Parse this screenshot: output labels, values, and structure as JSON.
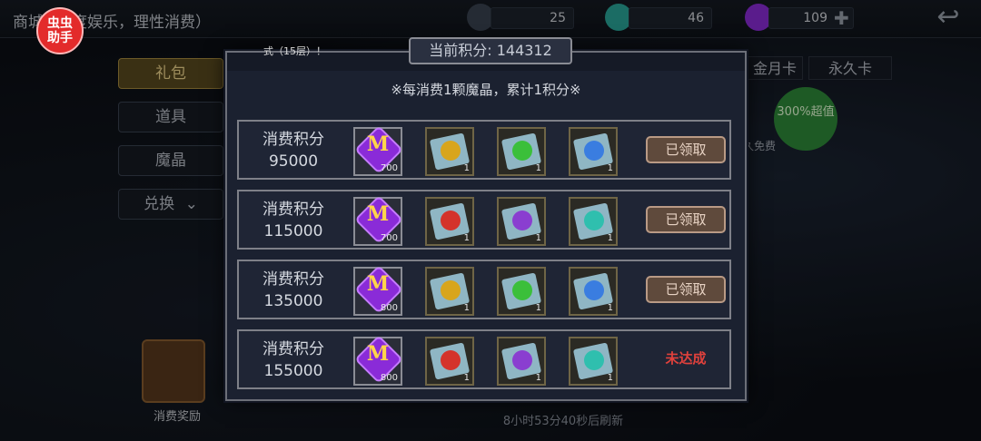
{
  "colors": {
    "modal_bg": "#1b2130",
    "claimed_btn": "#5f4a3c",
    "not_reached": "#e0413c",
    "gem_purple": "#8a2bd8"
  },
  "app_badge": "虫虫助手",
  "shop": {
    "title": "商城",
    "subtitle": "适度娱乐，理性消费）",
    "resources": [
      {
        "icon": "leaf-icon",
        "value": "25"
      },
      {
        "icon": "slime-icon",
        "value": "46"
      },
      {
        "icon": "magic-crystal-icon",
        "value": "109"
      }
    ],
    "side_menu": [
      "礼包",
      "道具",
      "魔晶",
      "兑换"
    ],
    "tabs": [
      "金月卡",
      "永久卡"
    ],
    "promo": "300%超值",
    "promo_sub": "久免费",
    "chest_label": "消费奖励",
    "refresh": "8小时53分40秒后刷新"
  },
  "modal": {
    "floor_note": "式（15层）！",
    "points_label": "当前积分:",
    "points_value": "144312",
    "rule": "※每消费1颗魔晶，累计1积分※",
    "rows": [
      {
        "label": "消费积分",
        "threshold": "95000",
        "gem_qty": "700",
        "items": [
          {
            "icon": "scroll-yellow-rune-icon",
            "qty": "1",
            "seal": "#d8a51c"
          },
          {
            "icon": "scroll-green-rune-icon",
            "qty": "1",
            "seal": "#3bbf3a"
          },
          {
            "icon": "scroll-blue-drop-icon",
            "qty": "1",
            "seal": "#3a7de0"
          }
        ],
        "status": "已领取",
        "claimed": true
      },
      {
        "label": "消费积分",
        "threshold": "115000",
        "gem_qty": "700",
        "items": [
          {
            "icon": "scroll-red-rune-icon",
            "qty": "1",
            "seal": "#d4332b"
          },
          {
            "icon": "scroll-purple-rune-icon",
            "qty": "1",
            "seal": "#8a3ed0"
          },
          {
            "icon": "scroll-teal-rune-icon",
            "qty": "1",
            "seal": "#2fbfae"
          }
        ],
        "status": "已领取",
        "claimed": true
      },
      {
        "label": "消费积分",
        "threshold": "135000",
        "gem_qty": "800",
        "items": [
          {
            "icon": "scroll-yellow-rune-icon",
            "qty": "1",
            "seal": "#d8a51c"
          },
          {
            "icon": "scroll-green-rune-icon",
            "qty": "1",
            "seal": "#3bbf3a"
          },
          {
            "icon": "scroll-blue-drop-icon",
            "qty": "1",
            "seal": "#3a7de0"
          }
        ],
        "status": "已领取",
        "claimed": true
      },
      {
        "label": "消费积分",
        "threshold": "155000",
        "gem_qty": "800",
        "items": [
          {
            "icon": "scroll-red-rune-icon",
            "qty": "1",
            "seal": "#d4332b"
          },
          {
            "icon": "scroll-purple-rune-icon",
            "qty": "1",
            "seal": "#8a3ed0"
          },
          {
            "icon": "scroll-teal-rune-icon",
            "qty": "1",
            "seal": "#2fbfae"
          }
        ],
        "status": "未达成",
        "claimed": false
      }
    ]
  }
}
